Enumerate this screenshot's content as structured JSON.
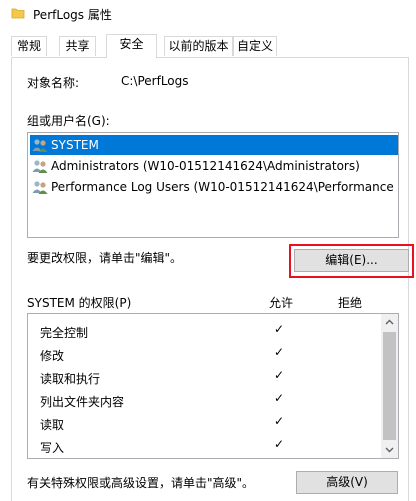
{
  "window": {
    "title": "PerfLogs 属性"
  },
  "tabs": [
    {
      "label": "常规"
    },
    {
      "label": "共享"
    },
    {
      "label": "安全"
    },
    {
      "label": "以前的版本"
    },
    {
      "label": "自定义"
    }
  ],
  "object": {
    "label": "对象名称:",
    "value": "C:\\PerfLogs"
  },
  "groups": {
    "label": "组或用户名(G):",
    "items": [
      {
        "name": "SYSTEM"
      },
      {
        "name": "Administrators (W10-01512141624\\Administrators)"
      },
      {
        "name": "Performance Log Users (W10-01512141624\\Performance ..."
      }
    ]
  },
  "change_perm": {
    "text": "要更改权限，请单击\"编辑\"。",
    "button": "编辑(E)..."
  },
  "permissions": {
    "label": "SYSTEM 的权限(P)",
    "allow_header": "允许",
    "deny_header": "拒绝",
    "rows": [
      {
        "name": "完全控制",
        "allow": "✓"
      },
      {
        "name": "修改",
        "allow": "✓"
      },
      {
        "name": "读取和执行",
        "allow": "✓"
      },
      {
        "name": "列出文件夹内容",
        "allow": "✓"
      },
      {
        "name": "读取",
        "allow": "✓"
      },
      {
        "name": "写入",
        "allow": "✓"
      }
    ]
  },
  "advanced": {
    "text": "有关特殊权限或高级设置，请单击\"高级\"。",
    "button": "高级(V)"
  },
  "colors": {
    "selection": "#0078d7",
    "highlight_border": "#e81123"
  },
  "icons": {
    "folder": "folder-icon",
    "user_group": "user-group-icon",
    "check": "checkmark-icon"
  }
}
